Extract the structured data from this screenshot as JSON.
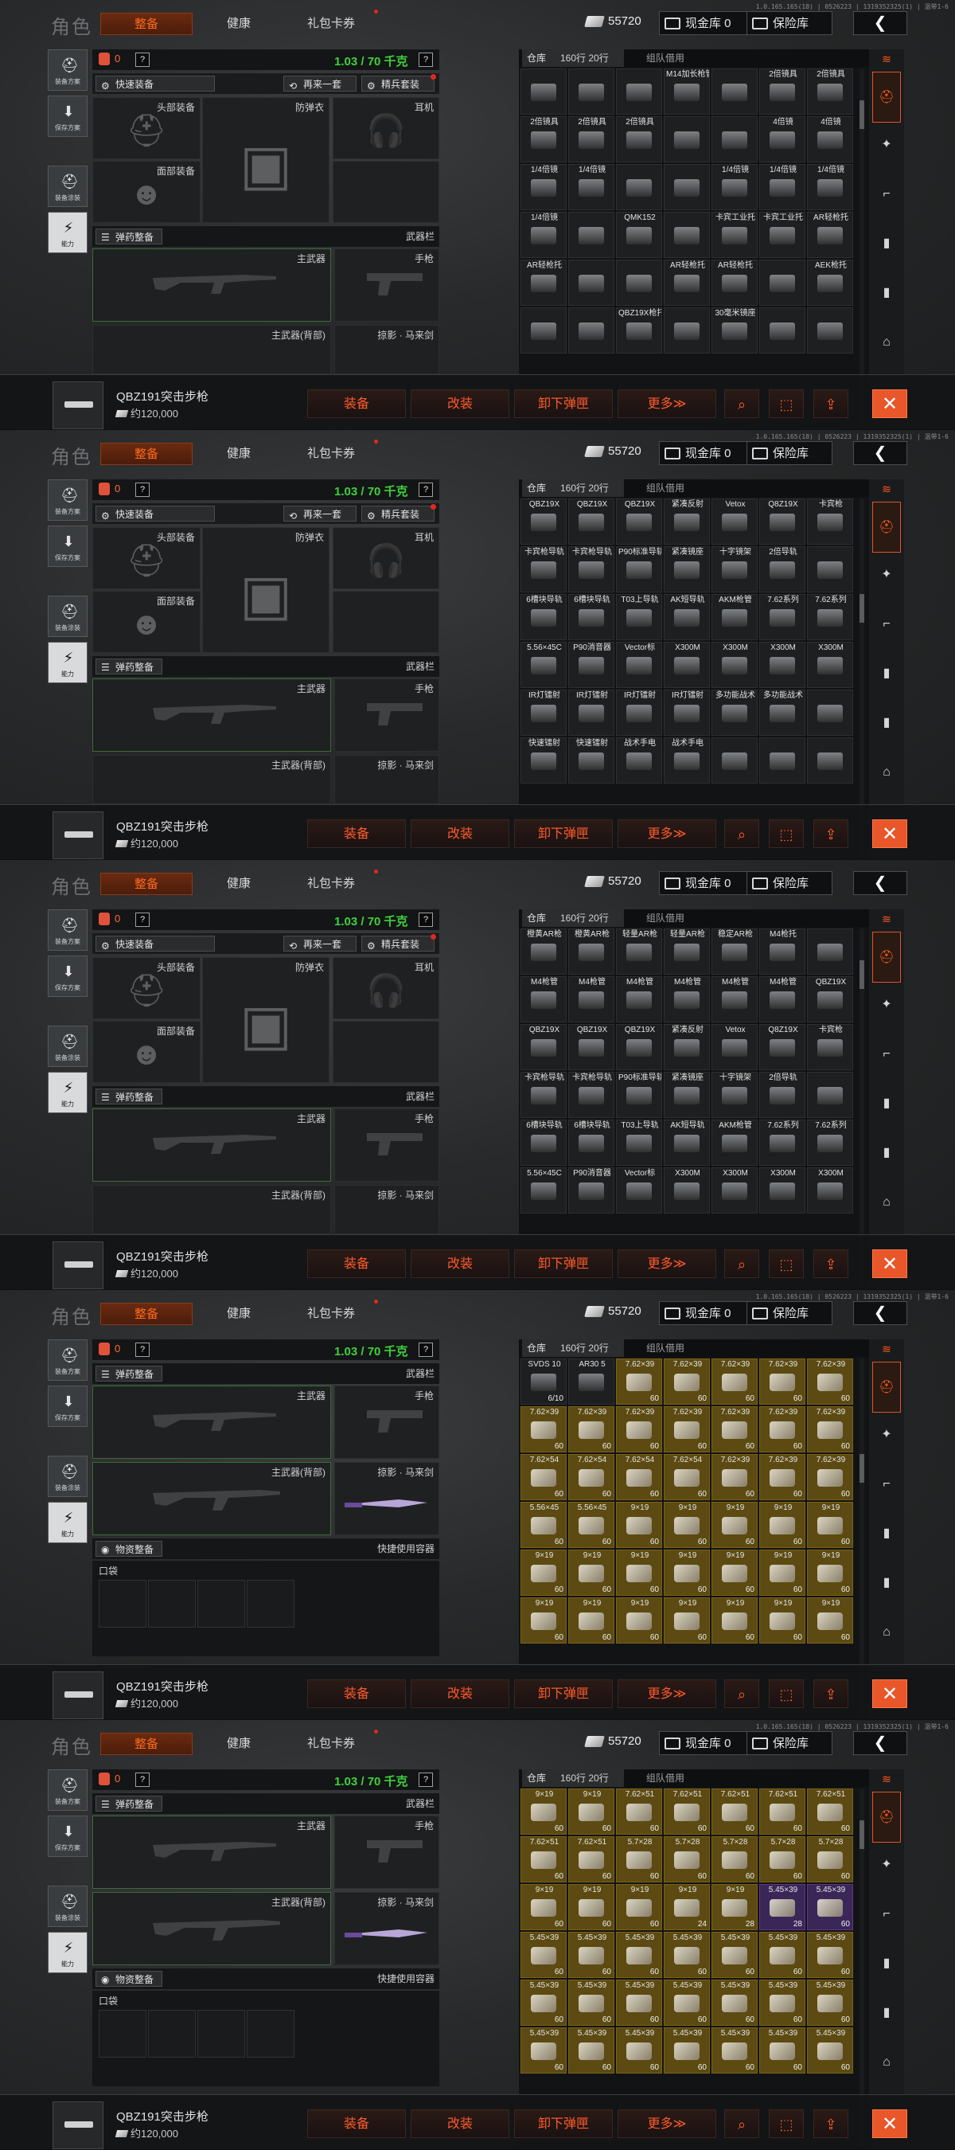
{
  "panels": [
    {
      "version": "1.0.165.165(18) | 0526223 | 1319352325(1) | 温带1-6",
      "view": "gear",
      "storage_mode": "attachments",
      "cells": [
        {
          "t": "",
          "n": "",
          "c": "n"
        },
        {
          "t": "",
          "n": "",
          "c": "n"
        },
        {
          "t": "",
          "n": "",
          "c": "n"
        },
        {
          "t": "M14加长枪管",
          "n": "",
          "c": "n"
        },
        {
          "t": "",
          "n": "",
          "c": "n"
        },
        {
          "t": "2倍镜具",
          "n": "",
          "c": "n"
        },
        {
          "t": "2倍镜具",
          "n": "",
          "c": "n"
        },
        {
          "t": "2倍镜具",
          "n": "",
          "c": "n"
        },
        {
          "t": "2倍镜具",
          "n": "",
          "c": "n"
        },
        {
          "t": "2倍镜具",
          "n": "",
          "c": "n"
        },
        {
          "t": "",
          "n": "",
          "c": "n"
        },
        {
          "t": "",
          "n": "",
          "c": "n"
        },
        {
          "t": "4倍镜",
          "n": "",
          "c": "n"
        },
        {
          "t": "4倍镜",
          "n": "",
          "c": "n"
        },
        {
          "t": "1/4倍镜",
          "n": "",
          "c": "n"
        },
        {
          "t": "1/4倍镜",
          "n": "",
          "c": "n"
        },
        {
          "t": "",
          "n": "",
          "c": "n"
        },
        {
          "t": "",
          "n": "",
          "c": "n"
        },
        {
          "t": "1/4倍镜",
          "n": "",
          "c": "n"
        },
        {
          "t": "1/4倍镜",
          "n": "",
          "c": "n"
        },
        {
          "t": "1/4倍镜",
          "n": "",
          "c": "n"
        },
        {
          "t": "1/4倍镜",
          "n": "",
          "c": "n"
        },
        {
          "t": "",
          "n": "",
          "c": "n"
        },
        {
          "t": "QMK152",
          "n": "",
          "c": "n"
        },
        {
          "t": "",
          "n": "",
          "c": "n"
        },
        {
          "t": "卡宾工业托",
          "n": "",
          "c": "n"
        },
        {
          "t": "卡宾工业托",
          "n": "",
          "c": "n"
        },
        {
          "t": "AR轻枪托",
          "n": "",
          "c": "n"
        },
        {
          "t": "AR轻枪托",
          "n": "",
          "c": "n"
        },
        {
          "t": "",
          "n": "",
          "c": "n"
        },
        {
          "t": "",
          "n": "",
          "c": "n"
        },
        {
          "t": "AR轻枪托",
          "n": "",
          "c": "n"
        },
        {
          "t": "AR轻枪托",
          "n": "",
          "c": "n"
        },
        {
          "t": "",
          "n": "",
          "c": "n"
        },
        {
          "t": "AEK枪托",
          "n": "",
          "c": "n"
        },
        {
          "t": "",
          "n": "",
          "c": "n"
        },
        {
          "t": "",
          "n": "",
          "c": "n"
        },
        {
          "t": "QBZ19X枪托",
          "n": "",
          "c": "n"
        },
        {
          "t": "",
          "n": "",
          "c": "n"
        },
        {
          "t": "30毫米镜座",
          "n": "",
          "c": "n"
        },
        {
          "t": "",
          "n": "",
          "c": "n"
        },
        {
          "t": "",
          "n": "",
          "c": "n"
        }
      ]
    },
    {
      "version": "1.0.165.165(18) | 0526223 | 1319352325(1) | 温带1-6",
      "view": "gear",
      "storage_mode": "attachments",
      "cells": [
        {
          "t": "QBZ19X",
          "n": "",
          "c": "n"
        },
        {
          "t": "QBZ19X",
          "n": "",
          "c": "n"
        },
        {
          "t": "QBZ19X",
          "n": "",
          "c": "n"
        },
        {
          "t": "紧凑反射",
          "n": "",
          "c": "n"
        },
        {
          "t": "Vetox",
          "n": "",
          "c": "n"
        },
        {
          "t": "Q8Z19X",
          "n": "",
          "c": "n"
        },
        {
          "t": "卡宾枪",
          "n": "",
          "c": "n"
        },
        {
          "t": "卡宾枪导轨",
          "n": "",
          "c": "n"
        },
        {
          "t": "卡宾枪导轨",
          "n": "",
          "c": "n"
        },
        {
          "t": "P90标准导轨",
          "n": "",
          "c": "n"
        },
        {
          "t": "紧凑镜座",
          "n": "",
          "c": "n"
        },
        {
          "t": "十字镜架",
          "n": "",
          "c": "n"
        },
        {
          "t": "2倍导轨",
          "n": "",
          "c": "n"
        },
        {
          "t": "",
          "n": "",
          "c": "n"
        },
        {
          "t": "6槽块导轨",
          "n": "",
          "c": "n"
        },
        {
          "t": "6槽块导轨",
          "n": "",
          "c": "n"
        },
        {
          "t": "T03上导轨",
          "n": "",
          "c": "n"
        },
        {
          "t": "AK短导轨",
          "n": "",
          "c": "n"
        },
        {
          "t": "AKM枪管",
          "n": "",
          "c": "n"
        },
        {
          "t": "7.62系列",
          "n": "",
          "c": "n"
        },
        {
          "t": "7.62系列",
          "n": "",
          "c": "n"
        },
        {
          "t": "5.56×45C",
          "n": "",
          "c": "n"
        },
        {
          "t": "P90消音器",
          "n": "",
          "c": "n"
        },
        {
          "t": "Vector标",
          "n": "",
          "c": "n"
        },
        {
          "t": "X300M",
          "n": "",
          "c": "n"
        },
        {
          "t": "X300M",
          "n": "",
          "c": "n"
        },
        {
          "t": "X300M",
          "n": "",
          "c": "n"
        },
        {
          "t": "X300M",
          "n": "",
          "c": "n"
        },
        {
          "t": "IR灯镭射",
          "n": "",
          "c": "n"
        },
        {
          "t": "IR灯镭射",
          "n": "",
          "c": "n"
        },
        {
          "t": "IR灯镭射",
          "n": "",
          "c": "n"
        },
        {
          "t": "IR灯镭射",
          "n": "",
          "c": "n"
        },
        {
          "t": "多功能战术",
          "n": "",
          "c": "n"
        },
        {
          "t": "多功能战术",
          "n": "",
          "c": "n"
        },
        {
          "t": "",
          "n": "",
          "c": "n"
        },
        {
          "t": "快速镭射",
          "n": "",
          "c": "n"
        },
        {
          "t": "快速镭射",
          "n": "",
          "c": "n"
        },
        {
          "t": "战术手电",
          "n": "",
          "c": "n"
        },
        {
          "t": "战术手电",
          "n": "",
          "c": "n"
        },
        {
          "t": "",
          "n": "",
          "c": "n"
        },
        {
          "t": "",
          "n": "",
          "c": "n"
        },
        {
          "t": "",
          "n": "",
          "c": "n"
        }
      ]
    },
    {
      "version": "",
      "view": "gear",
      "storage_mode": "attachments",
      "cells": [
        {
          "t": "橙黄AR枪",
          "n": "",
          "c": "n"
        },
        {
          "t": "橙黄AR枪",
          "n": "",
          "c": "n"
        },
        {
          "t": "轻量AR枪",
          "n": "",
          "c": "n"
        },
        {
          "t": "轻量AR枪",
          "n": "",
          "c": "n"
        },
        {
          "t": "稳定AR枪",
          "n": "",
          "c": "n"
        },
        {
          "t": "M4枪托",
          "n": "",
          "c": "n"
        },
        {
          "t": "",
          "n": "",
          "c": "n"
        },
        {
          "t": "M4枪管",
          "n": "",
          "c": "n"
        },
        {
          "t": "M4枪管",
          "n": "",
          "c": "n"
        },
        {
          "t": "M4枪管",
          "n": "",
          "c": "n"
        },
        {
          "t": "M4枪管",
          "n": "",
          "c": "n"
        },
        {
          "t": "M4枪管",
          "n": "",
          "c": "n"
        },
        {
          "t": "M4枪管",
          "n": "",
          "c": "n"
        },
        {
          "t": "QBZ19X",
          "n": "",
          "c": "n"
        },
        {
          "t": "QBZ19X",
          "n": "",
          "c": "n"
        },
        {
          "t": "QBZ19X",
          "n": "",
          "c": "n"
        },
        {
          "t": "QBZ19X",
          "n": "",
          "c": "n"
        },
        {
          "t": "紧凑反射",
          "n": "",
          "c": "n"
        },
        {
          "t": "Vetox",
          "n": "",
          "c": "n"
        },
        {
          "t": "Q8Z19X",
          "n": "",
          "c": "n"
        },
        {
          "t": "卡宾枪",
          "n": "",
          "c": "n"
        },
        {
          "t": "卡宾枪导轨",
          "n": "",
          "c": "n"
        },
        {
          "t": "卡宾枪导轨",
          "n": "",
          "c": "n"
        },
        {
          "t": "P90标准导轨",
          "n": "",
          "c": "n"
        },
        {
          "t": "紧凑镜座",
          "n": "",
          "c": "n"
        },
        {
          "t": "十字镜架",
          "n": "",
          "c": "n"
        },
        {
          "t": "2倍导轨",
          "n": "",
          "c": "n"
        },
        {
          "t": "",
          "n": "",
          "c": "n"
        },
        {
          "t": "6槽块导轨",
          "n": "",
          "c": "n"
        },
        {
          "t": "6槽块导轨",
          "n": "",
          "c": "n"
        },
        {
          "t": "T03上导轨",
          "n": "",
          "c": "n"
        },
        {
          "t": "AK短导轨",
          "n": "",
          "c": "n"
        },
        {
          "t": "AKM枪管",
          "n": "",
          "c": "n"
        },
        {
          "t": "7.62系列",
          "n": "",
          "c": "n"
        },
        {
          "t": "7.62系列",
          "n": "",
          "c": "n"
        },
        {
          "t": "5.56×45C",
          "n": "",
          "c": "n"
        },
        {
          "t": "P90消音器",
          "n": "",
          "c": "n"
        },
        {
          "t": "Vector标",
          "n": "",
          "c": "n"
        },
        {
          "t": "X300M",
          "n": "",
          "c": "n"
        },
        {
          "t": "X300M",
          "n": "",
          "c": "n"
        },
        {
          "t": "X300M",
          "n": "",
          "c": "n"
        },
        {
          "t": "X300M",
          "n": "",
          "c": "n"
        }
      ]
    },
    {
      "version": "1.0.165.165(18) | 0526223 | 1319352325(1) | 温带1-6",
      "view": "pockets",
      "storage_mode": "ammo",
      "cells": [
        {
          "t": "SVDS 10",
          "n": "6/10",
          "c": "n"
        },
        {
          "t": "AR30 5",
          "n": "",
          "c": "n"
        },
        {
          "t": "7.62×39",
          "n": "60",
          "c": "a"
        },
        {
          "t": "7.62×39",
          "n": "60",
          "c": "a"
        },
        {
          "t": "7.62×39",
          "n": "60",
          "c": "a"
        },
        {
          "t": "7.62×39",
          "n": "60",
          "c": "a"
        },
        {
          "t": "7.62×39",
          "n": "60",
          "c": "a"
        },
        {
          "t": "7.62×39",
          "n": "60",
          "c": "a"
        },
        {
          "t": "7.62×39",
          "n": "60",
          "c": "a"
        },
        {
          "t": "7.62×39",
          "n": "60",
          "c": "a"
        },
        {
          "t": "7.62×39",
          "n": "60",
          "c": "a"
        },
        {
          "t": "7.62×39",
          "n": "60",
          "c": "a"
        },
        {
          "t": "7.62×39",
          "n": "60",
          "c": "a"
        },
        {
          "t": "7.62×39",
          "n": "60",
          "c": "a"
        },
        {
          "t": "7.62×54",
          "n": "60",
          "c": "a"
        },
        {
          "t": "7.62×54",
          "n": "60",
          "c": "a"
        },
        {
          "t": "7.62×54",
          "n": "60",
          "c": "a"
        },
        {
          "t": "7.62×54",
          "n": "60",
          "c": "a"
        },
        {
          "t": "7.62×39",
          "n": "60",
          "c": "a"
        },
        {
          "t": "7.62×39",
          "n": "60",
          "c": "a"
        },
        {
          "t": "7.62×39",
          "n": "60",
          "c": "a"
        },
        {
          "t": "5.56×45",
          "n": "60",
          "c": "a"
        },
        {
          "t": "5.56×45",
          "n": "60",
          "c": "a"
        },
        {
          "t": "9×19",
          "n": "60",
          "c": "a"
        },
        {
          "t": "9×19",
          "n": "60",
          "c": "a"
        },
        {
          "t": "9×19",
          "n": "60",
          "c": "a"
        },
        {
          "t": "9×19",
          "n": "60",
          "c": "a"
        },
        {
          "t": "9×19",
          "n": "60",
          "c": "a"
        },
        {
          "t": "9×19",
          "n": "60",
          "c": "a"
        },
        {
          "t": "9×19",
          "n": "60",
          "c": "a"
        },
        {
          "t": "9×19",
          "n": "60",
          "c": "a"
        },
        {
          "t": "9×19",
          "n": "60",
          "c": "a"
        },
        {
          "t": "9×19",
          "n": "60",
          "c": "a"
        },
        {
          "t": "9×19",
          "n": "60",
          "c": "a"
        },
        {
          "t": "9×19",
          "n": "60",
          "c": "a"
        },
        {
          "t": "9×19",
          "n": "60",
          "c": "a"
        },
        {
          "t": "9×19",
          "n": "60",
          "c": "a"
        },
        {
          "t": "9×19",
          "n": "60",
          "c": "a"
        },
        {
          "t": "9×19",
          "n": "60",
          "c": "a"
        },
        {
          "t": "9×19",
          "n": "60",
          "c": "a"
        },
        {
          "t": "9×19",
          "n": "60",
          "c": "a"
        },
        {
          "t": "9×19",
          "n": "60",
          "c": "a"
        }
      ]
    },
    {
      "version": "1.0.165.165(18) | 0526223 | 1319352325(1) | 温带1-6",
      "view": "pockets",
      "storage_mode": "ammo",
      "cells": [
        {
          "t": "9×19",
          "n": "60",
          "c": "a"
        },
        {
          "t": "9×19",
          "n": "60",
          "c": "a"
        },
        {
          "t": "7.62×51",
          "n": "60",
          "c": "a"
        },
        {
          "t": "7.62×51",
          "n": "60",
          "c": "a"
        },
        {
          "t": "7.62×51",
          "n": "60",
          "c": "a"
        },
        {
          "t": "7.62×51",
          "n": "60",
          "c": "a"
        },
        {
          "t": "7.62×51",
          "n": "60",
          "c": "a"
        },
        {
          "t": "7.62×51",
          "n": "60",
          "c": "a"
        },
        {
          "t": "7.62×51",
          "n": "60",
          "c": "a"
        },
        {
          "t": "5.7×28",
          "n": "60",
          "c": "a"
        },
        {
          "t": "5.7×28",
          "n": "60",
          "c": "a"
        },
        {
          "t": "5.7×28",
          "n": "60",
          "c": "a"
        },
        {
          "t": "5.7×28",
          "n": "60",
          "c": "a"
        },
        {
          "t": "5.7×28",
          "n": "60",
          "c": "a"
        },
        {
          "t": "9×19",
          "n": "60",
          "c": "a"
        },
        {
          "t": "9×19",
          "n": "60",
          "c": "a"
        },
        {
          "t": "9×19",
          "n": "60",
          "c": "a"
        },
        {
          "t": "9×19",
          "n": "24",
          "c": "a"
        },
        {
          "t": "9×19",
          "n": "28",
          "c": "a"
        },
        {
          "t": "5.45×39",
          "n": "28",
          "c": "e"
        },
        {
          "t": "5.45×39",
          "n": "60",
          "c": "e"
        },
        {
          "t": "5.45×39",
          "n": "60",
          "c": "a"
        },
        {
          "t": "5.45×39",
          "n": "60",
          "c": "a"
        },
        {
          "t": "5.45×39",
          "n": "60",
          "c": "a"
        },
        {
          "t": "5.45×39",
          "n": "60",
          "c": "a"
        },
        {
          "t": "5.45×39",
          "n": "60",
          "c": "a"
        },
        {
          "t": "5.45×39",
          "n": "60",
          "c": "a"
        },
        {
          "t": "5.45×39",
          "n": "60",
          "c": "a"
        },
        {
          "t": "5.45×39",
          "n": "60",
          "c": "a"
        },
        {
          "t": "5.45×39",
          "n": "60",
          "c": "a"
        },
        {
          "t": "5.45×39",
          "n": "60",
          "c": "a"
        },
        {
          "t": "5.45×39",
          "n": "60",
          "c": "a"
        },
        {
          "t": "5.45×39",
          "n": "60",
          "c": "a"
        },
        {
          "t": "5.45×39",
          "n": "60",
          "c": "a"
        },
        {
          "t": "5.45×39",
          "n": "60",
          "c": "a"
        },
        {
          "t": "5.45×39",
          "n": "60",
          "c": "a"
        },
        {
          "t": "5.45×39",
          "n": "60",
          "c": "a"
        },
        {
          "t": "5.45×39",
          "n": "60",
          "c": "a"
        },
        {
          "t": "5.45×39",
          "n": "60",
          "c": "a"
        },
        {
          "t": "5.45×39",
          "n": "60",
          "c": "a"
        },
        {
          "t": "5.45×39",
          "n": "60",
          "c": "a"
        },
        {
          "t": "5.45×39",
          "n": "60",
          "c": "a"
        }
      ]
    }
  ],
  "ui": {
    "title": "角色",
    "tabs": [
      "整备",
      "健康",
      "礼包卡券"
    ],
    "coins": "55720",
    "cash_label": "现金库 0",
    "safe_label": "保险库",
    "sidebar": [
      "装备方案",
      "保存方案",
      "装备涂装",
      "能力"
    ],
    "backpack_count": "0",
    "weight": "1.03 / 70 千克",
    "quick_equip": "快速装备",
    "again": "再来一套",
    "elite": "精兵套装",
    "slot_head": "头部装备",
    "slot_armor": "防弹衣",
    "slot_ear": "耳机",
    "slot_face": "面部装备",
    "ammo_prep": "弹药整备",
    "weapon_bar": "武器栏",
    "main_weapon": "主武器",
    "pistol": "手枪",
    "main_back": "主武器(背部)",
    "melee": "掠影 · 马来剑",
    "supply_prep": "物资整备",
    "quick_container": "快捷使用容器",
    "pocket": "口袋",
    "storage_tab": "仓库",
    "storage_count": "160行",
    "storage_count2": "20行",
    "loan": "组队借用",
    "gun_name": "QBZ191突击步枪",
    "gun_price": "约120,000",
    "btn_equip": "装备",
    "btn_mod": "改装",
    "btn_unload": "卸下弹匣",
    "btn_more": "更多≫",
    "accent": "#ff5a1c",
    "weight_color": "#3dd23a"
  }
}
